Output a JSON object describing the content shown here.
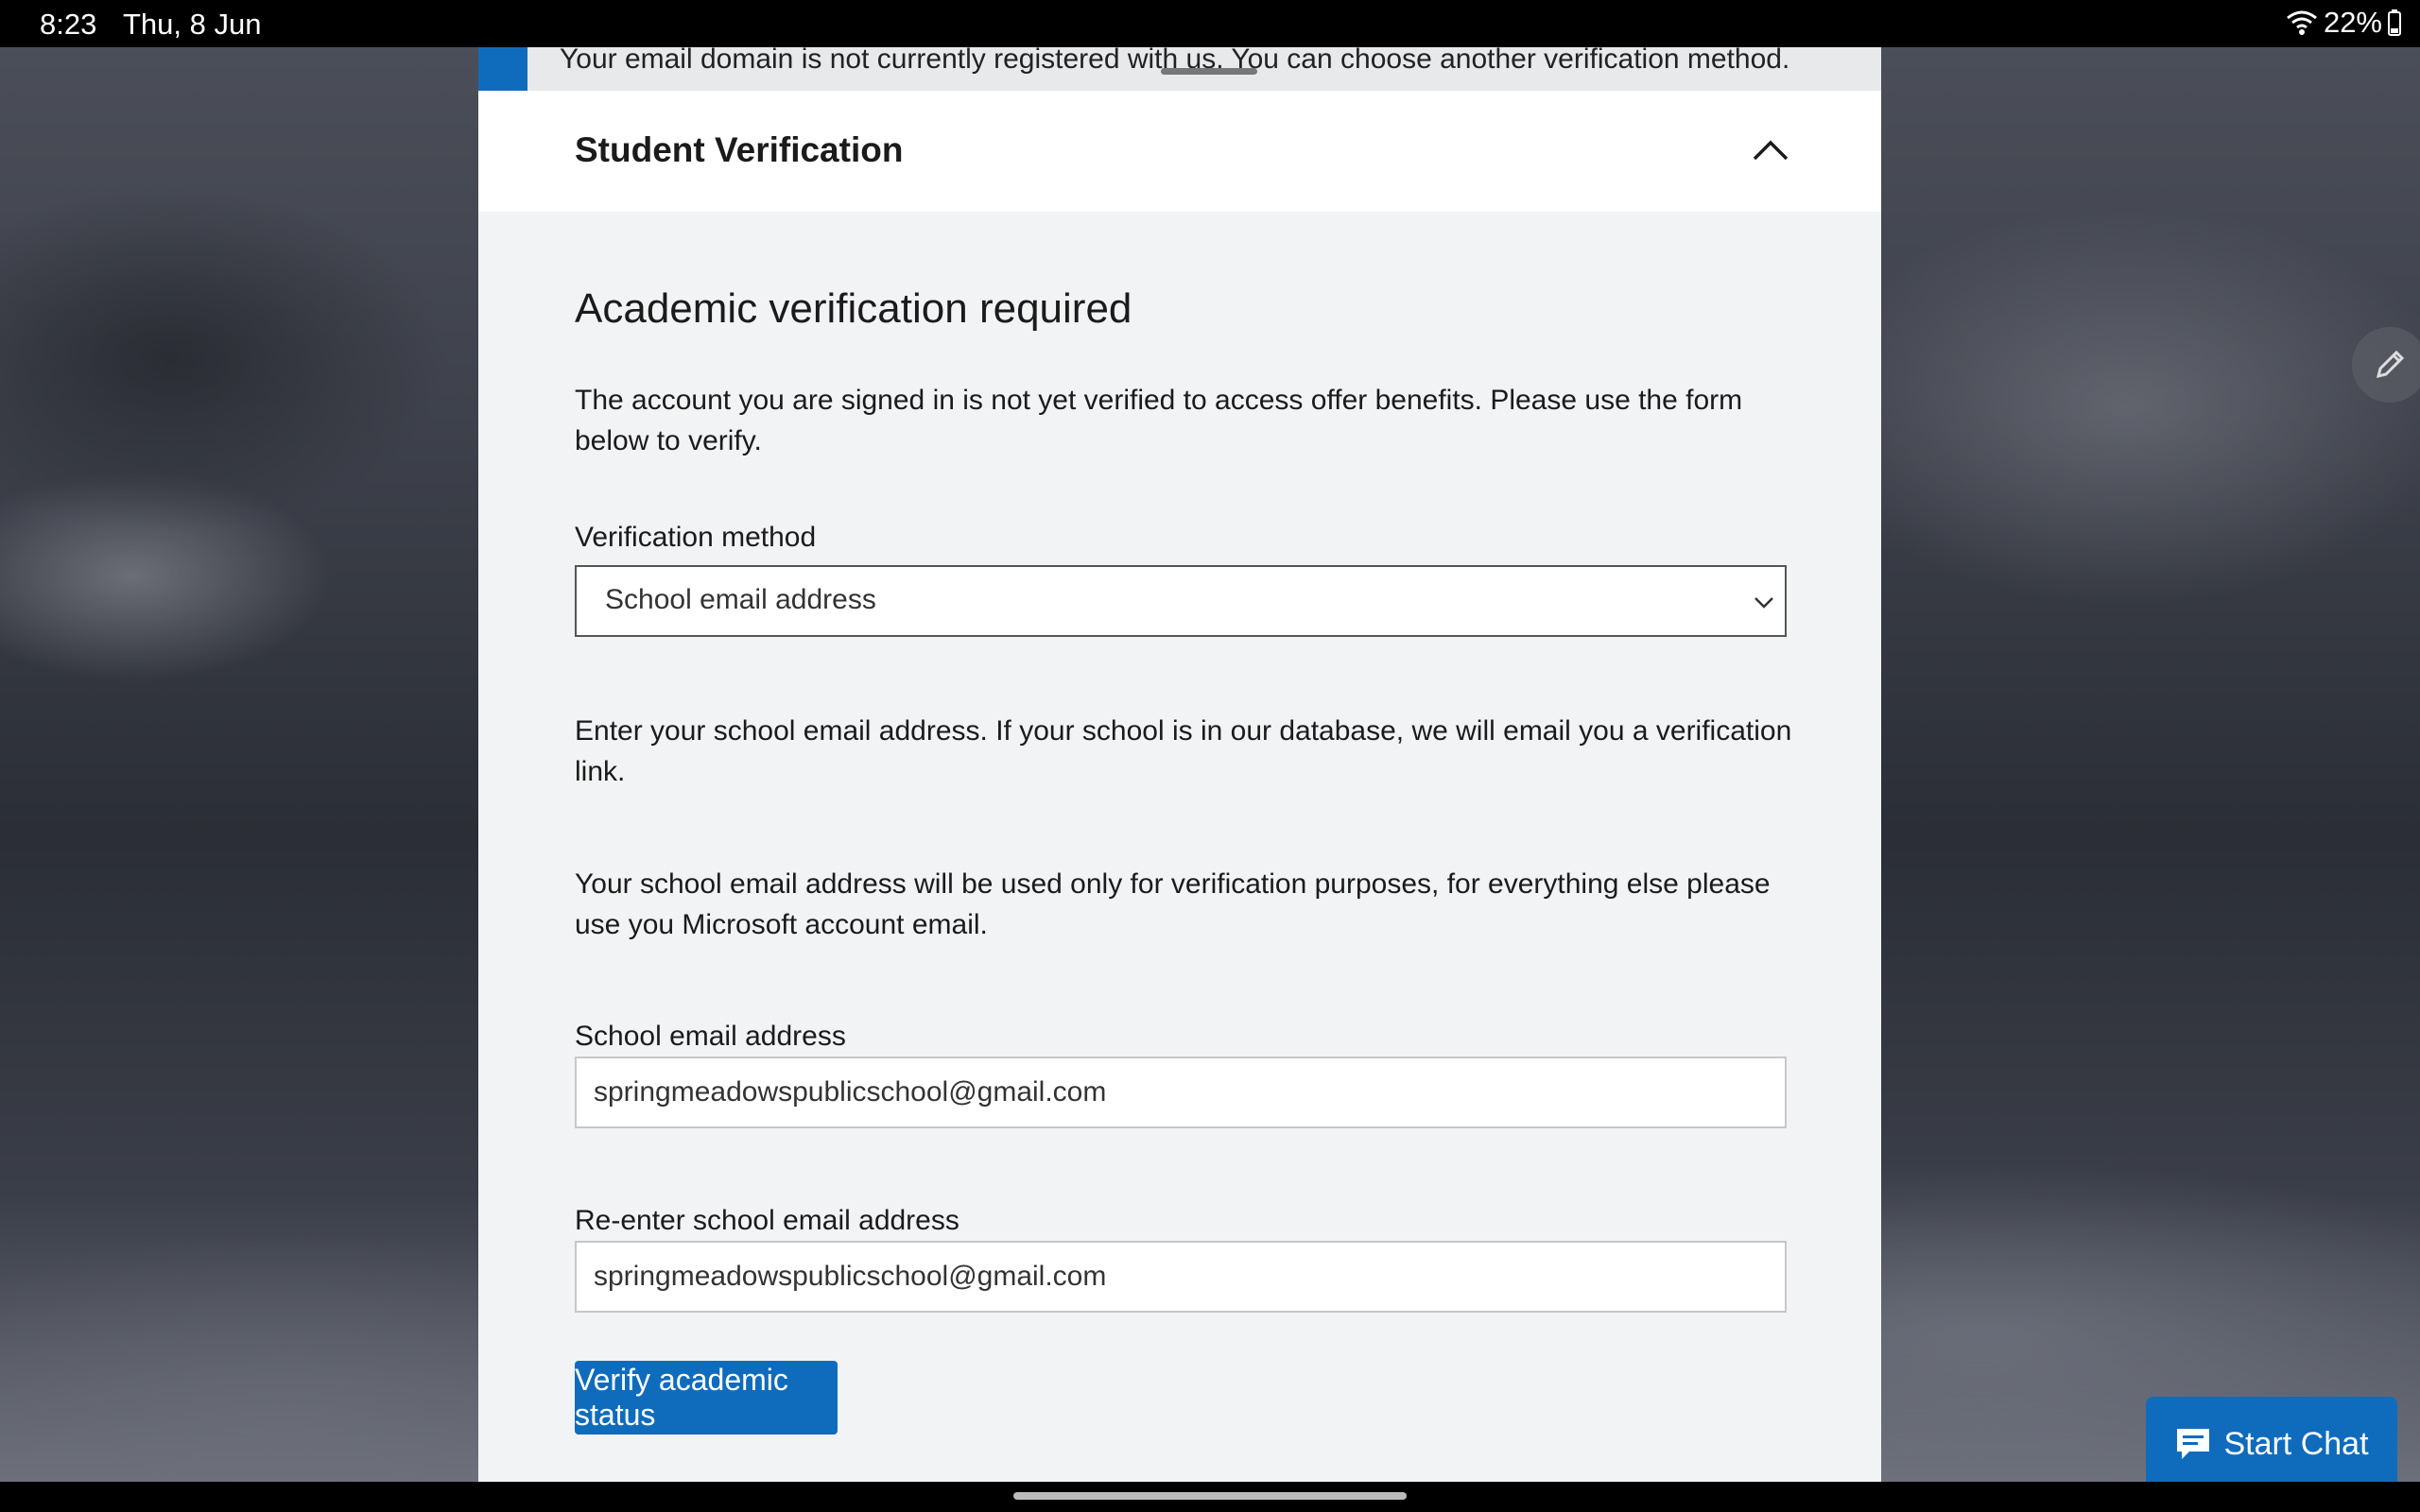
{
  "status_bar": {
    "time": "8:23",
    "date": "Thu, 8 Jun",
    "battery": "22%",
    "icons": [
      "wifi-icon",
      "battery-icon"
    ]
  },
  "notice": {
    "text": "Your email domain is not currently registered with us. You can choose another verification method.",
    "accent_color": "#0f6cbd"
  },
  "section": {
    "title": "Student Verification",
    "toggle_icon": "chevron-up-icon"
  },
  "main": {
    "heading": "Academic verification required",
    "intro": "The account you are signed in is not yet verified to access offer benefits. Please use the form below to verify.",
    "method_label": "Verification method",
    "method_value": "School email address",
    "instructions": "Enter your school email address. If your school is in our database, we will email you a verification link.",
    "privacy_note": "Your school email address will be used only for verification purposes, for everything else please use you Microsoft account email.",
    "email_label": "School email address",
    "email_value": "springmeadowspublicschool@gmail.com",
    "reenter_label": "Re-enter school email address",
    "reenter_value": "springmeadowspublicschool@gmail.com",
    "submit_label": "Verify academic status"
  },
  "chat": {
    "label": "Start Chat",
    "icon": "chat-bubble-icon"
  },
  "floating": {
    "icon": "pencil-icon"
  }
}
